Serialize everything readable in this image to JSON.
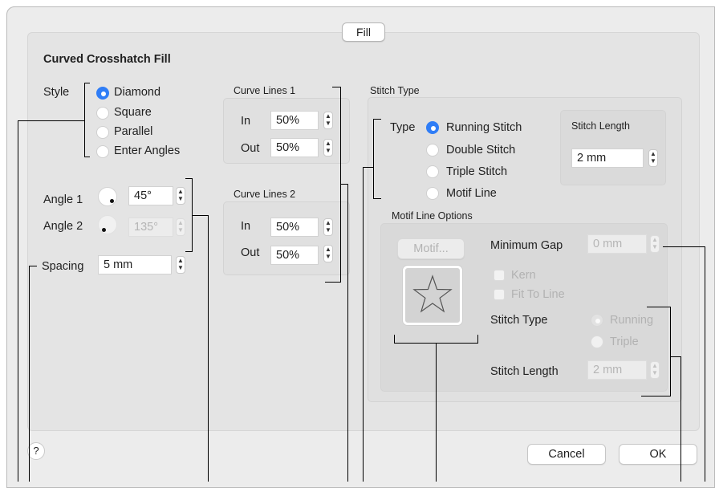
{
  "tab": "Fill",
  "title": "Curved Crosshatch Fill",
  "style": {
    "label": "Style",
    "options": [
      "Diamond",
      "Square",
      "Parallel",
      "Enter Angles"
    ],
    "selected": "Diamond"
  },
  "angles": {
    "angle1_label": "Angle 1",
    "angle1_value": "45°",
    "angle2_label": "Angle 2",
    "angle2_value": "135°"
  },
  "spacing": {
    "label": "Spacing",
    "value": "5 mm"
  },
  "curve_lines_1": {
    "title": "Curve Lines 1",
    "in_label": "In",
    "in_value": "50%",
    "out_label": "Out",
    "out_value": "50%"
  },
  "curve_lines_2": {
    "title": "Curve Lines 2",
    "in_label": "In",
    "in_value": "50%",
    "out_label": "Out",
    "out_value": "50%"
  },
  "stitch_type": {
    "title": "Stitch Type",
    "type_label": "Type",
    "options": [
      "Running Stitch",
      "Double Stitch",
      "Triple Stitch",
      "Motif Line"
    ],
    "selected": "Running Stitch",
    "length_title": "Stitch Length",
    "length_value": "2 mm"
  },
  "motif": {
    "title": "Motif Line Options",
    "button": "Motif...",
    "min_gap_label": "Minimum Gap",
    "min_gap_value": "0 mm",
    "kern": "Kern",
    "fit_to_line": "Fit To Line",
    "stitch_type_label": "Stitch Type",
    "stitch_options": [
      "Running",
      "Triple"
    ],
    "stitch_length_label": "Stitch Length",
    "stitch_length_value": "2 mm"
  },
  "footer": {
    "help": "?",
    "cancel": "Cancel",
    "ok": "OK"
  },
  "colors": {
    "accent": "#2f7df6",
    "panel": "#e4e4e4",
    "window": "#ececec"
  }
}
